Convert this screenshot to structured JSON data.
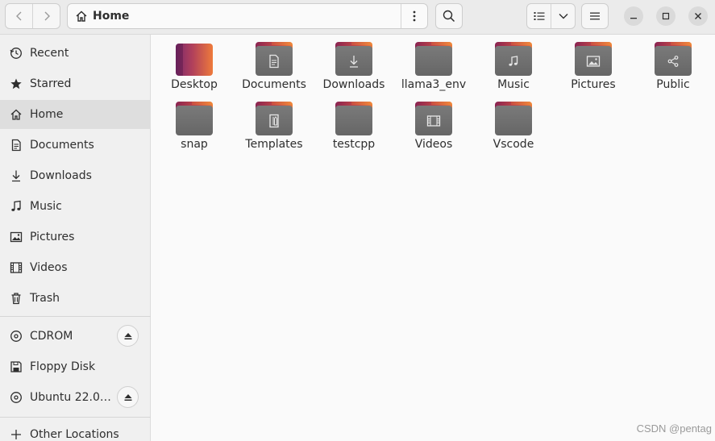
{
  "header": {
    "path": {
      "label": "Home",
      "icon": "home-icon"
    },
    "nav": {
      "back_icon": "chevron-left-icon",
      "forward_icon": "chevron-right-icon"
    },
    "buttons": {
      "path_menu_icon": "vertical-dots-icon",
      "search_icon": "search-icon",
      "view_list_icon": "list-view-icon",
      "view_dropdown_icon": "chevron-down-icon",
      "main_menu_icon": "hamburger-icon"
    },
    "window": {
      "minimize_icon": "minimize-icon",
      "maximize_icon": "maximize-icon",
      "close_icon": "close-icon"
    }
  },
  "sidebar": {
    "places": [
      {
        "label": "Recent",
        "icon": "clock-icon"
      },
      {
        "label": "Starred",
        "icon": "star-icon"
      },
      {
        "label": "Home",
        "icon": "home-icon",
        "selected": true
      },
      {
        "label": "Documents",
        "icon": "document-icon"
      },
      {
        "label": "Downloads",
        "icon": "download-icon"
      },
      {
        "label": "Music",
        "icon": "music-icon"
      },
      {
        "label": "Pictures",
        "icon": "picture-icon"
      },
      {
        "label": "Videos",
        "icon": "video-icon"
      },
      {
        "label": "Trash",
        "icon": "trash-icon"
      }
    ],
    "devices": [
      {
        "label": "CDROM",
        "icon": "disc-icon",
        "eject": true
      },
      {
        "label": "Floppy Disk",
        "icon": "floppy-icon",
        "eject": false
      },
      {
        "label": "Ubuntu 22.0…",
        "icon": "disc-icon",
        "eject": true
      }
    ],
    "other": {
      "label": "Other Locations",
      "icon": "plus-icon"
    }
  },
  "files": [
    {
      "name": "Desktop",
      "emblem": ""
    },
    {
      "name": "Documents",
      "emblem": "document"
    },
    {
      "name": "Downloads",
      "emblem": "download"
    },
    {
      "name": "llama3_env",
      "emblem": ""
    },
    {
      "name": "Music",
      "emblem": "music"
    },
    {
      "name": "Pictures",
      "emblem": "picture"
    },
    {
      "name": "Public",
      "emblem": "share"
    },
    {
      "name": "snap",
      "emblem": ""
    },
    {
      "name": "Templates",
      "emblem": "template"
    },
    {
      "name": "testcpp",
      "emblem": ""
    },
    {
      "name": "Videos",
      "emblem": "video"
    },
    {
      "name": "Vscode",
      "emblem": ""
    }
  ],
  "watermark": "CSDN @pentag"
}
